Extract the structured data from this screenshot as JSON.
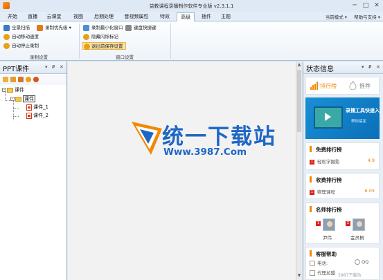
{
  "window": {
    "title": "益教课程录播制作软件专业版 v2.3.1.1",
    "minimize": "─",
    "maximize": "□",
    "close": "✕"
  },
  "tabs": [
    "开始",
    "直播",
    "云课堂",
    "视图",
    "后期处理",
    "音视频属性",
    "特效",
    "高级",
    "插件",
    "主题"
  ],
  "active_tab": "高级",
  "tabs_right": {
    "mode": "当前模式 ▾",
    "help": "帮助与支持 ▾"
  },
  "ribbon": {
    "group1": {
      "label": "录制设置",
      "buttons": [
        "全景扫描",
        "录制优先级 ▾",
        "自动移动速度",
        "自动停止录制"
      ]
    },
    "group2": {
      "label": "窗口设置",
      "buttons": [
        "录制最小化窗口",
        "键盘快捷键",
        "隐藏闪烁标记",
        "退出前保存设置"
      ]
    }
  },
  "left_pane": {
    "title": "PPT课件",
    "controls": [
      "▾",
      "₽",
      "✕"
    ],
    "tree": {
      "root": "课件",
      "child": "课件",
      "items": [
        "课件_1",
        "课件_2"
      ]
    }
  },
  "center": {
    "logo_cn": "统一下载站",
    "logo_url": "Www.3987.Com"
  },
  "right_pane": {
    "title": "状态信息",
    "controls": [
      "▾",
      "₽",
      "✕"
    ],
    "tabs": [
      "排行榜",
      "推荐"
    ],
    "banner": {
      "title": "录播工具快速入门",
      "subtitle": "帮你搞定"
    },
    "free_rank": {
      "title": "免费排行榜",
      "item": "轻松学摄影",
      "num": "1",
      "value": "4.9"
    },
    "paid_rank": {
      "title": "收费排行榜",
      "item": "物理课程",
      "num": "1",
      "value": "6.0¥"
    },
    "teacher_rank": {
      "title": "名师排行榜",
      "teachers": [
        {
          "num": "1",
          "name": "尹伟"
        },
        {
          "num": "2",
          "name": "金灵桐"
        }
      ]
    },
    "service": {
      "title": "客服帮助",
      "phone_label": "电话:",
      "agent_label": "代理加盟",
      "qq": "QQ"
    }
  },
  "watermark": "3987下载站",
  "colors": {
    "accent": "#f08a00",
    "brand_blue": "#1e66c5",
    "badge_red": "#d9251d"
  }
}
